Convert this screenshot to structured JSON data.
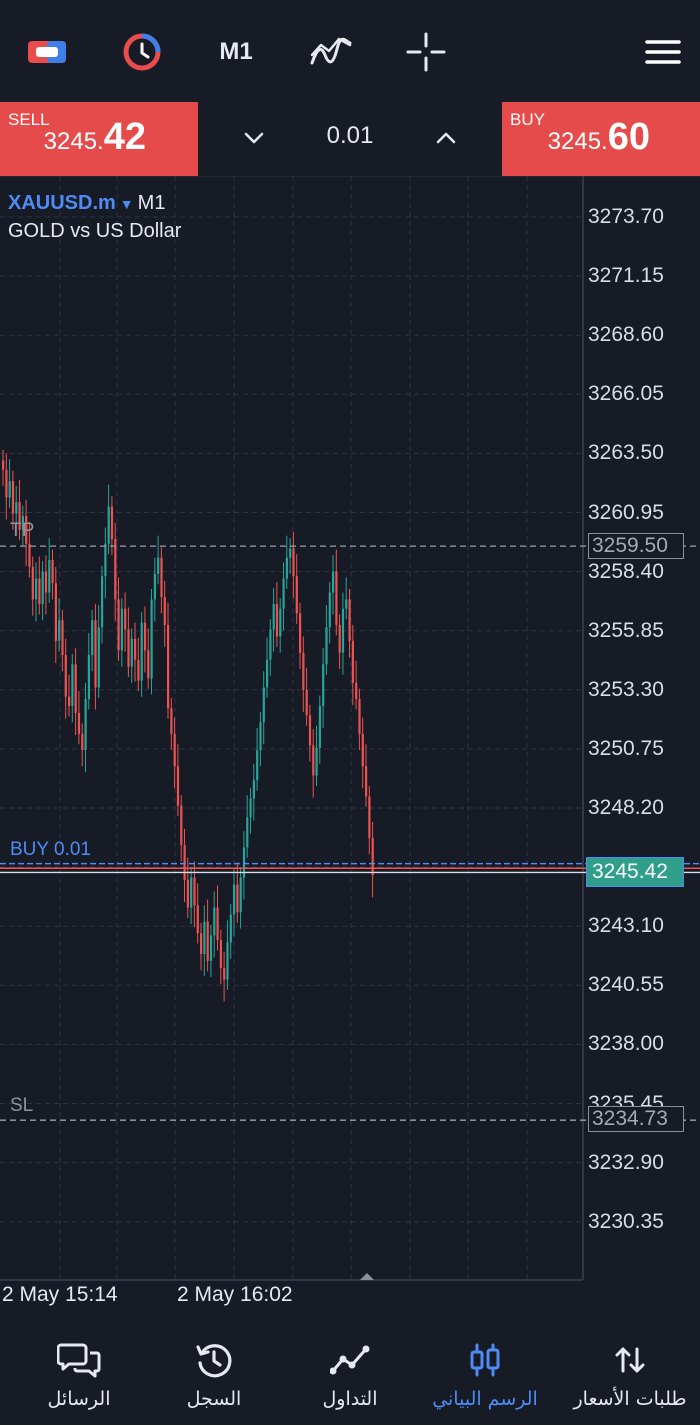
{
  "toolbar": {
    "timeframe": "M1",
    "icons": [
      "account-toggle-icon",
      "one-click-trading-icon",
      "indicators-icon",
      "crosshair-icon",
      "menu-icon"
    ]
  },
  "trade": {
    "sell_label": "SELL",
    "sell_price_small": "3245.",
    "sell_price_big": "42",
    "buy_label": "BUY",
    "buy_price_small": "3245.",
    "buy_price_big": "60",
    "volume": "0.01"
  },
  "chart": {
    "symbol": "XAUUSD.m",
    "timeframe": "M1",
    "description": "GOLD vs US Dollar",
    "tp_label": "TP",
    "sl_label": "SL",
    "position_label": "BUY 0.01",
    "tp_price": "3259.50",
    "sl_price": "3234.73",
    "current_price": "3245.42",
    "axis_prices": [
      "3273.70",
      "3271.15",
      "3268.60",
      "3266.05",
      "3263.50",
      "3260.95",
      "3258.40",
      "3255.85",
      "3253.30",
      "3250.75",
      "3248.20",
      "3243.10",
      "3240.55",
      "3238.00",
      "3235.45",
      "3232.90",
      "3230.35"
    ],
    "time_labels": [
      "2 May 15:14",
      "2 May 16:02"
    ],
    "colors": {
      "bull": "#26a69a",
      "bear": "#ef5350",
      "accent": "#4d8cf5",
      "sell_buy_box": "#e64b4b"
    }
  },
  "nav": {
    "items": [
      {
        "label": "الرسائل",
        "icon": "messages-icon"
      },
      {
        "label": "السجل",
        "icon": "history-icon"
      },
      {
        "label": "التداول",
        "icon": "trade-icon"
      },
      {
        "label": "الرسم البياني",
        "icon": "chart-icon",
        "active": true
      },
      {
        "label": "طلبات الأسعار",
        "icon": "quotes-icon"
      }
    ]
  }
}
